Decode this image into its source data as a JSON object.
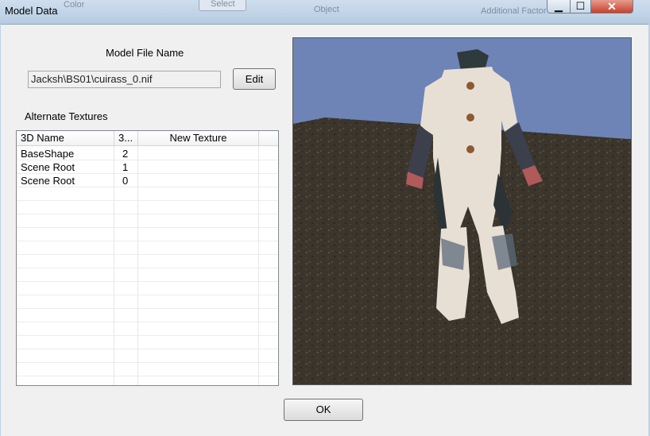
{
  "window": {
    "title": "Model Data",
    "background_ghost_text": [
      "Color",
      "Select",
      "Object",
      "Additional Factor"
    ],
    "controls": {
      "minimize_glyph": "▁",
      "maximize_glyph": "☐",
      "close_glyph": "✕"
    }
  },
  "model_file": {
    "label": "Model File Name",
    "value": "Jacksh\\BS01\\cuirass_0.nif",
    "edit_label": "Edit"
  },
  "textures": {
    "label": "Alternate Textures",
    "columns": [
      "3D Name",
      "3...",
      "New Texture"
    ],
    "rows": [
      {
        "name": "BaseShape",
        "count": "2",
        "texture": ""
      },
      {
        "name": "Scene Root",
        "count": "1",
        "texture": ""
      },
      {
        "name": "Scene Root",
        "count": "0",
        "texture": ""
      }
    ]
  },
  "preview": {
    "sky_color": "#6e84b6",
    "ground_color": "#3b352c",
    "outfit_color": "#e8dfd4"
  },
  "footer": {
    "ok_label": "OK"
  }
}
